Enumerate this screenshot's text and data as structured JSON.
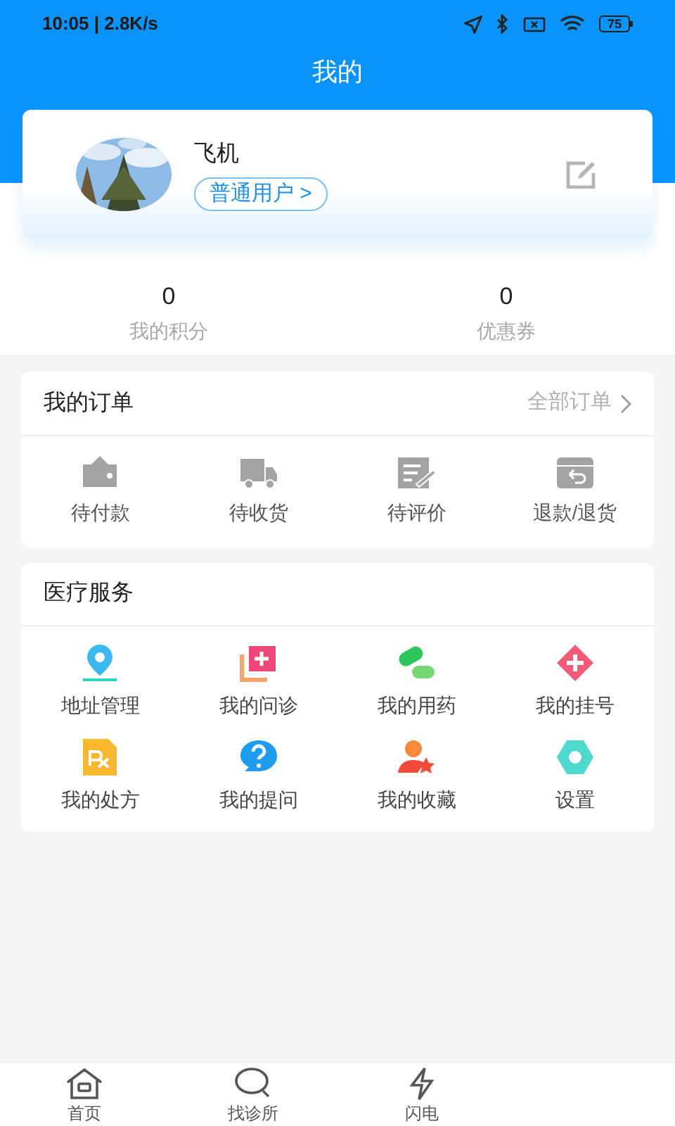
{
  "status_bar": {
    "time": "10:05 | 2.8K/s",
    "battery": "75"
  },
  "header": {
    "title": "我的"
  },
  "profile": {
    "name": "飞机",
    "badge": "普通用户 >"
  },
  "stats": [
    {
      "value": "0",
      "label": "我的积分"
    },
    {
      "value": "0",
      "label": "优惠券"
    }
  ],
  "orders": {
    "title": "我的订单",
    "link": "全部订单",
    "items": [
      {
        "kind": "wallet",
        "label": "待付款"
      },
      {
        "kind": "truck",
        "label": "待收货"
      },
      {
        "kind": "review",
        "label": "待评价"
      },
      {
        "kind": "refund",
        "label": "退款/退货"
      }
    ]
  },
  "services": {
    "title": "医疗服务",
    "items": [
      {
        "kind": "pin",
        "label": "地址管理"
      },
      {
        "kind": "consult",
        "label": "我的问诊"
      },
      {
        "kind": "pill",
        "label": "我的用药"
      },
      {
        "kind": "register",
        "label": "我的挂号"
      },
      {
        "kind": "rx",
        "label": "我的处方"
      },
      {
        "kind": "question",
        "label": "我的提问"
      },
      {
        "kind": "favorite",
        "label": "我的收藏"
      },
      {
        "kind": "settings",
        "label": "设置"
      }
    ]
  },
  "tab_bar": [
    {
      "kind": "home",
      "label": "首页",
      "selected": false
    },
    {
      "kind": "search",
      "label": "找诊所",
      "selected": false
    },
    {
      "kind": "flash",
      "label": "闪电",
      "selected": false
    }
  ]
}
